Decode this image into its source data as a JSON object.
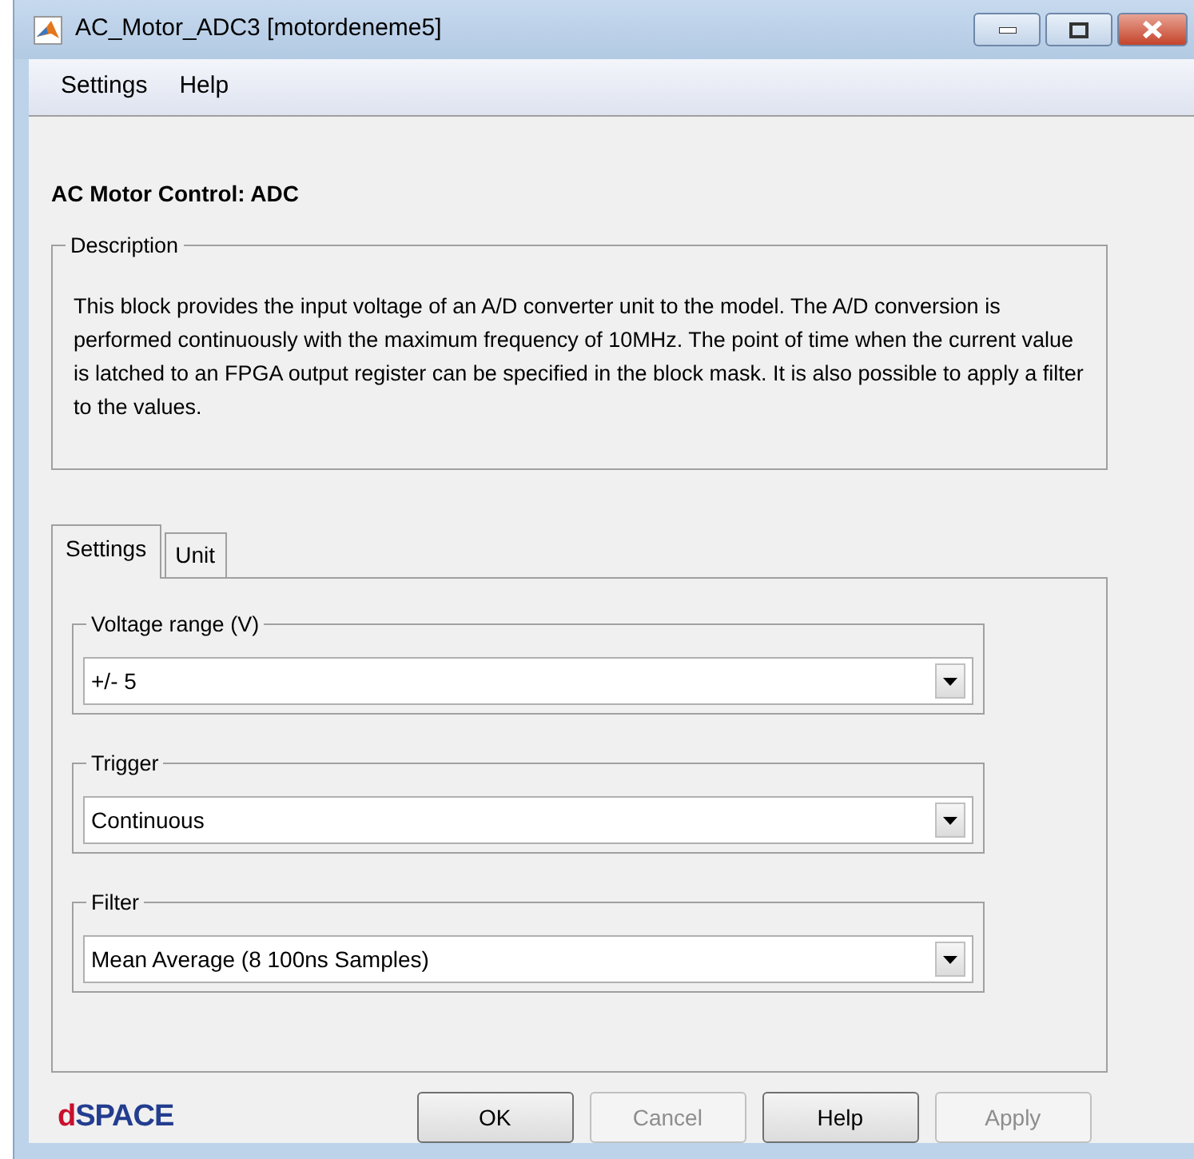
{
  "window": {
    "title": "AC_Motor_ADC3  [motordeneme5]"
  },
  "menu": [
    "Settings",
    "Help"
  ],
  "heading": "AC Motor Control: ADC",
  "description": {
    "legend": "Description",
    "text": "This block provides the input voltage of an A/D converter unit to the model. The A/D conversion is performed continuously with the maximum frequency of 10MHz. The point of time when the current value is latched to an FPGA output register can be specified in the block mask. It is also possible to apply a filter to the values."
  },
  "tabs": [
    {
      "label": "Settings",
      "selected": true
    },
    {
      "label": "Unit",
      "selected": false
    }
  ],
  "groups": [
    {
      "legend": "Voltage range (V)",
      "value": "+/- 5"
    },
    {
      "legend": "Trigger",
      "value": "Continuous"
    },
    {
      "legend": "Filter",
      "value": "Mean Average (8 100ns Samples)"
    }
  ],
  "logo": {
    "accent": "d",
    "rest": "SPACE"
  },
  "buttons": [
    {
      "label": "OK",
      "disabled": false
    },
    {
      "label": "Cancel",
      "disabled": true
    },
    {
      "label": "Help",
      "disabled": false
    },
    {
      "label": "Apply",
      "disabled": true
    }
  ]
}
